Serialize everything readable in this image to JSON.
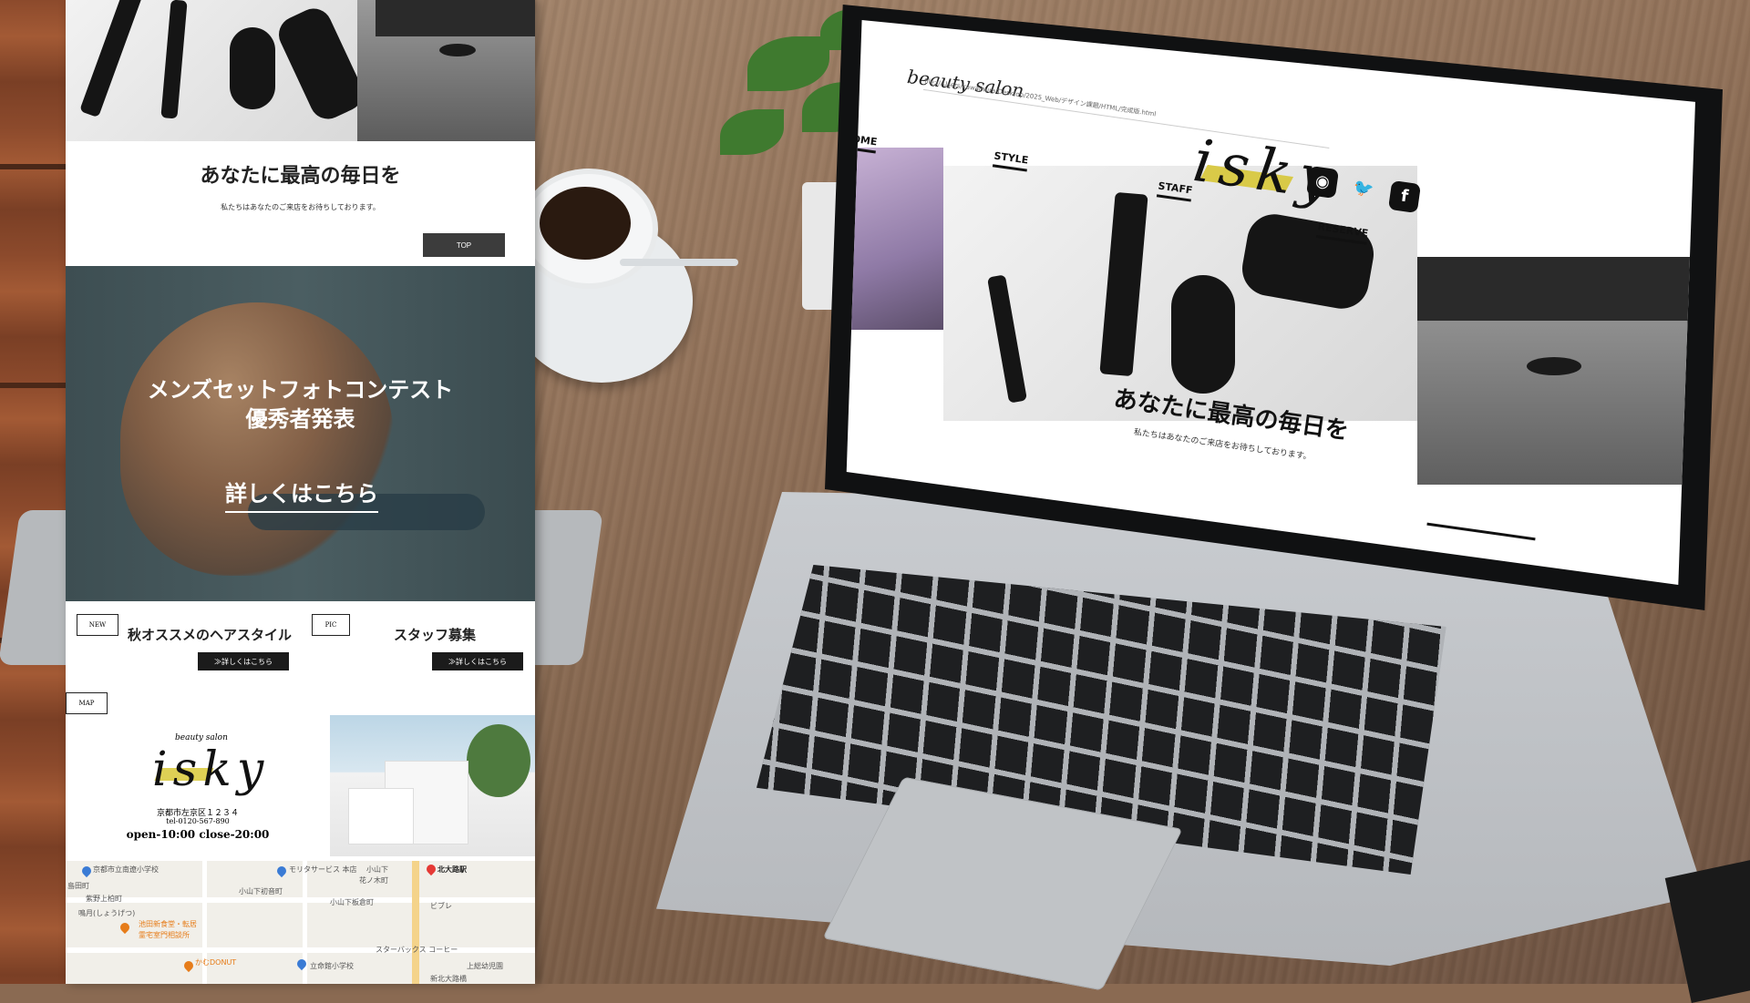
{
  "mobile_page": {
    "hero_title": "あなたに最高の毎日を",
    "hero_sub": "私たちはあなたのご来店をお待ちしております。",
    "top_button": "TOP",
    "contest": {
      "title": "メンズセットフォトコンテスト\n優秀者発表",
      "link": "詳しくはこちら"
    },
    "news": [
      {
        "tag": "NEW",
        "title": "秋オススメのヘアスタイル",
        "button": "≫詳しくはこちら"
      },
      {
        "tag": "PIC",
        "title": "スタッフ募集",
        "button": "≫詳しくはこちら"
      }
    ],
    "map_tag": "MAP",
    "info": {
      "brand": "beauty salon",
      "logo": "isky",
      "address": "京都市左京区１２３４",
      "tel": "tel-0120-567-890",
      "hours": "open-10:00  close-20:00"
    },
    "map_labels": {
      "school1": "京都市立南遼小学校",
      "service": "モリタサービス 本店",
      "station": "北大路駅",
      "area1": "島田町",
      "area2": "紫野上柏町",
      "area3": "鳴月(しょうげつ)",
      "area4": "小山下",
      "area5": "花ノ木町",
      "area6": "小山下初音町",
      "area7": "小山下板倉町",
      "store": "ビブレ",
      "shop1": "池田新食堂・転居",
      "shop2": "霊宅室門相談所",
      "cafe": "スターバックス コーヒー",
      "donut": "かむDONUT",
      "school2": "立命館小学校",
      "area8": "上総幼児園",
      "area9": "新北大路橋"
    }
  },
  "laptop_page": {
    "url": "file:///Users/kawamura/Desktop/2025_Web/デザイン課題/HTML/完成版.html",
    "brand": "beauty salon",
    "logo": "isky",
    "nav": [
      "HOME",
      "STYLE",
      "STAFF",
      "RESERVE"
    ],
    "tagline": "あなたに最高の毎日を",
    "subline": "私たちはあなたのご来店をお待ちしております。",
    "social": [
      "instagram-icon",
      "twitter-icon",
      "facebook-icon"
    ]
  },
  "colors": {
    "accent_yellow": "#d6c42b",
    "dark_button": "#1b1b1b"
  }
}
